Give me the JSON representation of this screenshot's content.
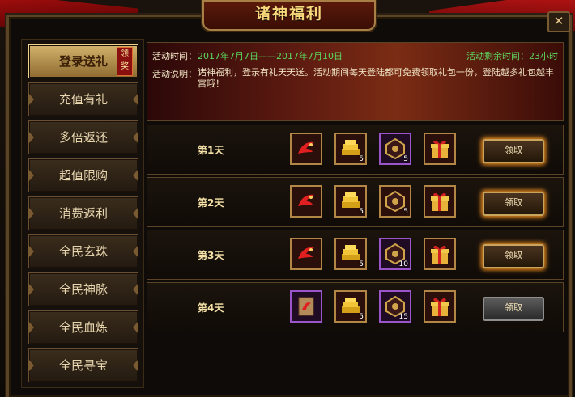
{
  "title": "诸神福利",
  "close_icon": "✕",
  "sidebar": {
    "items": [
      {
        "label": "登录送礼",
        "active": true,
        "badge": "领奖"
      },
      {
        "label": "充值有礼"
      },
      {
        "label": "多倍返还"
      },
      {
        "label": "超值限购"
      },
      {
        "label": "消费返利"
      },
      {
        "label": "全民玄珠"
      },
      {
        "label": "全民神脉"
      },
      {
        "label": "全民血炼"
      },
      {
        "label": "全民寻宝"
      }
    ]
  },
  "info": {
    "time_label": "活动时间：",
    "time_value": "2017年7月7日——2017年7月10日",
    "remaining": "活动剩余时间：23小时",
    "desc_label": "活动说明：",
    "desc_text": "诸神福利，登录有礼天天送。活动期间每天登陆都可免费领取礼包一份，登陆越多礼包越丰富哦！"
  },
  "rows": [
    {
      "day": "第1天",
      "counts": [
        "",
        "5",
        "5",
        ""
      ],
      "claim": "领取",
      "glow": true
    },
    {
      "day": "第2天",
      "counts": [
        "",
        "5",
        "5",
        ""
      ],
      "claim": "领取",
      "glow": true
    },
    {
      "day": "第3天",
      "counts": [
        "",
        "5",
        "10",
        ""
      ],
      "claim": "领取",
      "glow": true
    },
    {
      "day": "第4天",
      "counts": [
        "",
        "5",
        "15",
        ""
      ],
      "claim": "领取",
      "glow": false
    }
  ],
  "colors": {
    "accent_gold": "#f8d87a",
    "green_text": "#5dd85d",
    "frame": "#5b4326"
  }
}
